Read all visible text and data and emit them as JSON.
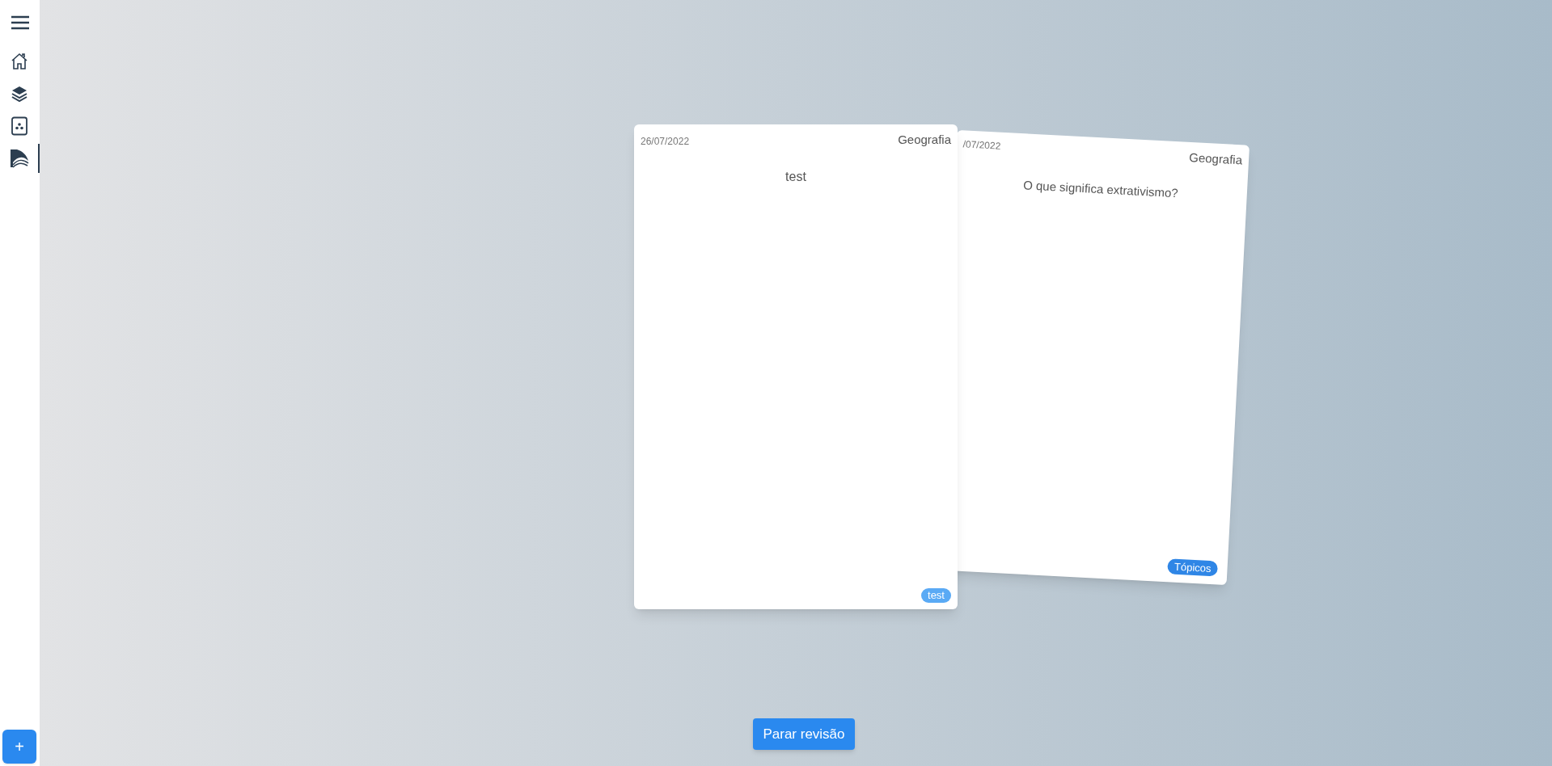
{
  "sidebar": {
    "items": [
      {
        "kind": "home",
        "selected": false
      },
      {
        "kind": "layers",
        "selected": false
      },
      {
        "kind": "dice",
        "selected": false
      },
      {
        "kind": "cards",
        "selected": true
      }
    ],
    "add_button": "+"
  },
  "cards": [
    {
      "date": "26/07/2022",
      "subject": "Geografia",
      "question": "test",
      "tag": "test"
    },
    {
      "date": "/07/2022",
      "subject": "Geografia",
      "question": "O que significa extrativismo?",
      "tag": "Tópicos"
    }
  ],
  "stop_button": "Parar revisão"
}
